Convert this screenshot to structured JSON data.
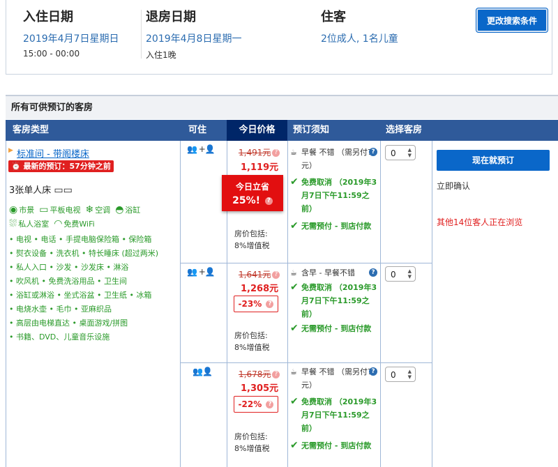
{
  "search": {
    "checkin": {
      "label": "入住日期",
      "date": "2019年4月7日星期日",
      "time": "15:00 - 00:00"
    },
    "checkout": {
      "label": "退房日期",
      "date": "2019年4月8日星期一",
      "nights": "入住1晚"
    },
    "guests": {
      "label": "住客",
      "value": "2位成人, 1名儿童"
    },
    "change_button": "更改搜索条件"
  },
  "rooms_title": "所有可供预订的客房",
  "table_headers": {
    "room_type": "客房类型",
    "occupancy": "可住",
    "price": "今日价格",
    "notes": "预订须知",
    "select": "选择客房"
  },
  "room": {
    "name": "标准间 - 带阁楼床",
    "last_booked": "最新的预订：57分钟之前",
    "bed": "3张单人床",
    "amenities_icons": [
      {
        "icon": "eye-icon",
        "label": "市景"
      },
      {
        "icon": "tv-icon",
        "label": "平板电视"
      },
      {
        "icon": "snowflake-icon",
        "label": "空调"
      },
      {
        "icon": "bathtub-icon",
        "label": "浴缸"
      },
      {
        "icon": "shower-icon",
        "label": "私人浴室"
      },
      {
        "icon": "wifi-icon",
        "label": "免费WiFi"
      }
    ],
    "amenities_lines": [
      "• 电视 • 电话 • 手提电脑保险箱 • 保险箱",
      "• 熨衣设备 • 洗衣机 • 特长睡床 (超过两米)",
      "• 私人入口 • 沙发 • 沙发床 • 淋浴",
      "• 吹风机 • 免费洗浴用品 • 卫生间",
      "• 浴缸或淋浴 • 坐式浴盆 • 卫生纸 • 冰箱",
      "• 电烧水壶 • 毛巾 • 亚麻织品",
      "• 高层由电梯直达 • 桌面游戏/拼图",
      "• 书籍、DVD、儿童音乐设施"
    ]
  },
  "options": [
    {
      "occupancy": "2 adults + 1 child",
      "old_price": "1,491元",
      "new_price": "1,119元",
      "deal_title": "今日立省",
      "deal_pct": "25%!",
      "includes": "房价包括:",
      "tax": "8%增值税",
      "meal": "早餐 不错 （需另付75元）",
      "cancel": "免费取消 （2019年3月7日下午11:59之前）",
      "prepay": "无需预付 - 到店付款",
      "select": "0"
    },
    {
      "occupancy": "2 adults + 1 child",
      "old_price": "1,641元",
      "new_price": "1,268元",
      "deal_pct": "-23%",
      "includes": "房价包括:",
      "tax": "8%增值税",
      "meal": "含早 - 早餐不错",
      "cancel": "免费取消 （2019年3月7日下午11:59之前）",
      "prepay": "无需预付 - 到店付款",
      "select": "0"
    },
    {
      "occupancy": "3 adults",
      "old_price": "1,678元",
      "new_price": "1,305元",
      "deal_pct": "-22%",
      "includes": "房价包括:",
      "tax": "8%增值税",
      "meal": "早餐 不错 （需另付75元）",
      "cancel": "免费取消 （2019年3月7日下午11:59之前）",
      "prepay": "无需预付 - 到店付款",
      "select": "0"
    }
  ],
  "book": {
    "button": "现在就预订",
    "confirm": "立即确认",
    "viewing": "其他14位客人正在浏览"
  },
  "colors": {
    "primary": "#0a67c9",
    "header": "#2f5a9a",
    "selected_header": "#002668",
    "deal": "#e20f10",
    "green": "#2a9a2a"
  }
}
